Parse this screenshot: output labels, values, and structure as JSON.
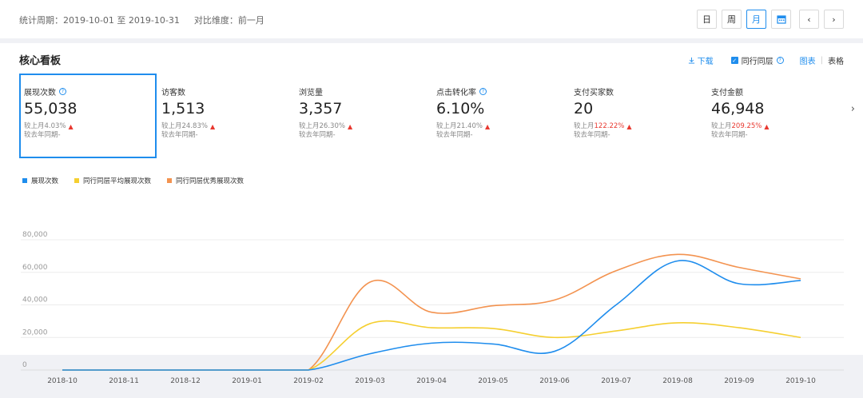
{
  "header": {
    "period_label": "统计周期：",
    "period_value": "2019-10-01 至 2019-10-31",
    "compare_label": "对比维度：",
    "compare_value": "前一月",
    "buttons": {
      "day": "日",
      "week": "周",
      "month": "月",
      "prev": "‹",
      "next": "›"
    }
  },
  "panel": {
    "title": "核心看板",
    "download": "下载",
    "peer_layer": "同行同层",
    "view_chart": "图表",
    "view_sep": "|",
    "view_table": "表格"
  },
  "metrics": [
    {
      "label": "展现次数",
      "value": "55,038",
      "mom_prefix": "较上月",
      "mom_value": "4.03%",
      "mom_red": false,
      "yoy": "较去年同期-",
      "help": true
    },
    {
      "label": "访客数",
      "value": "1,513",
      "mom_prefix": "较上月",
      "mom_value": "24.83%",
      "mom_red": false,
      "yoy": "较去年同期-",
      "help": false
    },
    {
      "label": "浏览量",
      "value": "3,357",
      "mom_prefix": "较上月",
      "mom_value": "26.30%",
      "mom_red": false,
      "yoy": "较去年同期-",
      "help": false
    },
    {
      "label": "点击转化率",
      "value": "6.10%",
      "mom_prefix": "较上月",
      "mom_value": "21.40%",
      "mom_red": false,
      "yoy": "较去年同期-",
      "help": true
    },
    {
      "label": "支付买家数",
      "value": "20",
      "mom_prefix": "较上月",
      "mom_value": "122.22%",
      "mom_red": true,
      "yoy": "较去年同期-",
      "help": false
    },
    {
      "label": "支付金额",
      "value": "46,948",
      "mom_prefix": "较上月",
      "mom_value": "209.25%",
      "mom_red": true,
      "yoy": "较去年同期-",
      "help": false
    }
  ],
  "colors": {
    "accent": "#1f8ded",
    "up": "#e8382f",
    "series1": "#1f8ded",
    "series2": "#f5cf30",
    "series3": "#f39350"
  },
  "chart_data": {
    "type": "line",
    "categories": [
      "2018-10",
      "2018-11",
      "2018-12",
      "2019-01",
      "2019-02",
      "2019-03",
      "2019-04",
      "2019-05",
      "2019-06",
      "2019-07",
      "2019-08",
      "2019-09",
      "2019-10"
    ],
    "ylim": [
      0,
      80000
    ],
    "yticks": [
      0,
      20000,
      40000,
      60000,
      80000
    ],
    "ytick_labels": [
      "0",
      "20,000",
      "40,000",
      "60,000",
      "80,000"
    ],
    "grid": true,
    "legend_position": "top-left",
    "series": [
      {
        "name": "展现次数",
        "color": "#1f8ded",
        "values": [
          0,
          0,
          0,
          0,
          0,
          10000,
          16500,
          16000,
          11500,
          40000,
          67000,
          53000,
          55000
        ]
      },
      {
        "name": "同行同层平均展现次数",
        "color": "#f5cf30",
        "values": [
          0,
          0,
          0,
          0,
          0,
          28500,
          26000,
          25500,
          20000,
          24000,
          29000,
          26000,
          20000
        ]
      },
      {
        "name": "同行同层优秀展现次数",
        "color": "#f39350",
        "values": [
          0,
          0,
          0,
          0,
          0,
          54000,
          35500,
          39500,
          43000,
          61000,
          71000,
          63000,
          56000
        ]
      }
    ]
  }
}
